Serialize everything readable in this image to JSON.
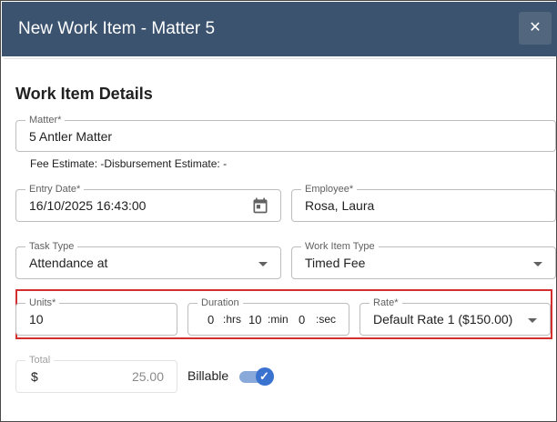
{
  "dialog": {
    "title": "New Work Item - Matter 5",
    "close_glyph": "✕"
  },
  "section": {
    "title": "Work Item Details"
  },
  "matter": {
    "label": "Matter*",
    "value": "5 Antler Matter"
  },
  "estimate_text": "Fee Estimate: -Disbursement Estimate: -",
  "entry_date": {
    "label": "Entry Date*",
    "value": "16/10/2025 16:43:00",
    "icon": "calendar-icon"
  },
  "employee": {
    "label": "Employee*",
    "value": "Rosa, Laura"
  },
  "task_type": {
    "label": "Task Type",
    "value": "Attendance at"
  },
  "work_item_type": {
    "label": "Work Item Type",
    "value": "Timed Fee"
  },
  "units": {
    "label": "Units*",
    "value": "10"
  },
  "duration": {
    "label": "Duration",
    "hrs_value": "0",
    "hrs_unit": ":hrs",
    "min_value": "10",
    "min_unit": ":min",
    "sec_value": "0",
    "sec_unit": ":sec"
  },
  "rate": {
    "label": "Rate*",
    "value": "Default Rate 1 ($150.00)"
  },
  "total": {
    "label": "Total",
    "currency": "$",
    "value": "25.00"
  },
  "billable": {
    "label": "Billable",
    "checked": true,
    "check_glyph": "✓"
  },
  "colors": {
    "header_bg": "#3b536f",
    "accent": "#3a73cf",
    "highlight_border": "#d32f2f"
  }
}
